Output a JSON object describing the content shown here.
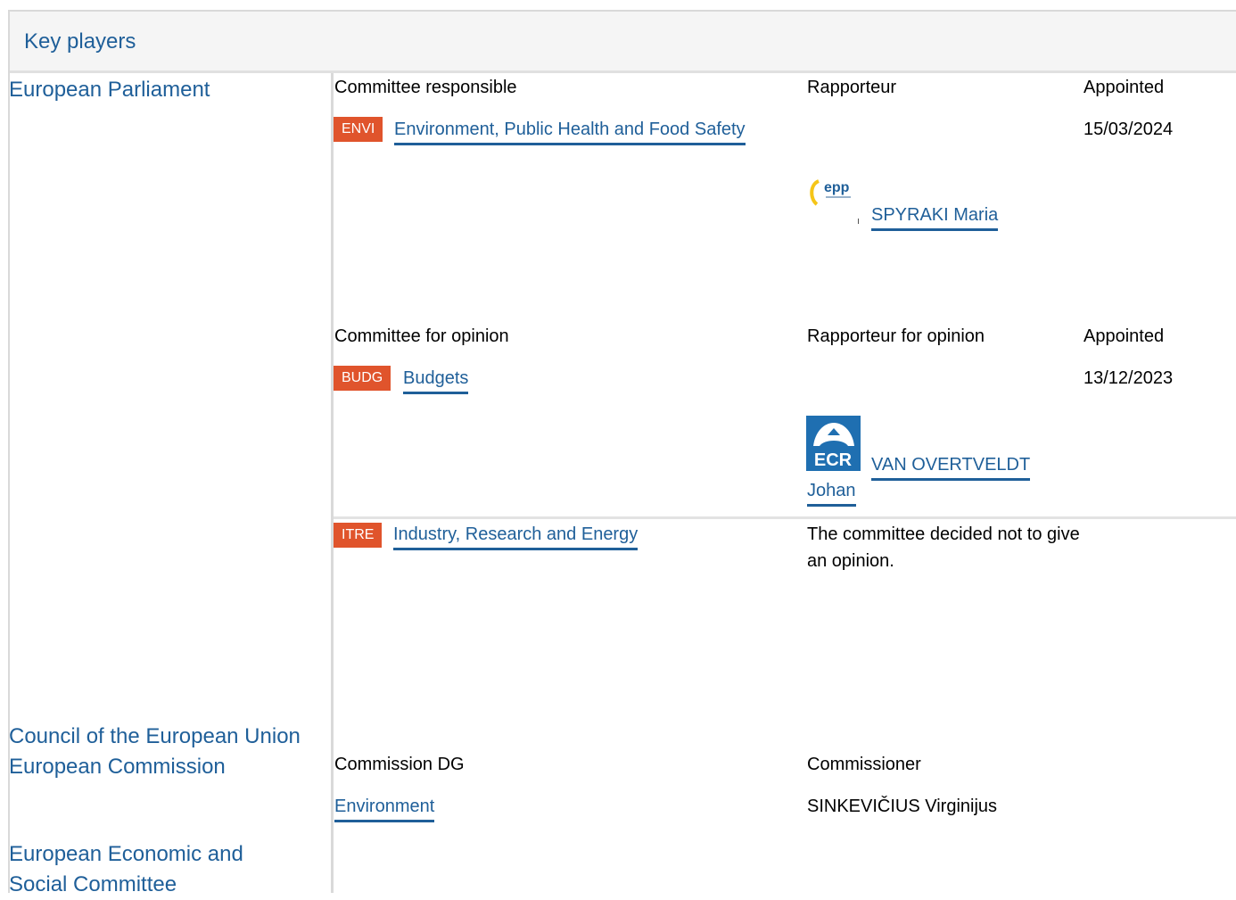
{
  "header": {
    "title": "Key players"
  },
  "institutions": {
    "parliament": "European Parliament",
    "council": "Council of the European Union",
    "commission": "European Commission",
    "eesc": "European Economic and Social Committee"
  },
  "responsible": {
    "col_committee": "Committee responsible",
    "col_rapporteur": "Rapporteur",
    "col_appointed": "Appointed",
    "committee_code": "ENVI",
    "committee_name": "Environment, Public Health and Food Safety",
    "appointed_date": "15/03/2024",
    "rapporteur_name": "SPYRAKI Maria",
    "group_logo": "epp-logo"
  },
  "opinion": {
    "col_committee": "Committee for opinion",
    "col_rapporteur": "Rapporteur for opinion",
    "col_appointed": "Appointed",
    "committee_code": "BUDG",
    "committee_name": "Budgets",
    "appointed_date": "13/12/2023",
    "rapporteur_name_line1": "VAN OVERTVELDT",
    "rapporteur_name_line2": "Johan",
    "group_logo": "ecr-logo",
    "group_logo_text": "ECR"
  },
  "opinion_itre": {
    "committee_code": "ITRE",
    "committee_name": "Industry, Research and Energy",
    "note": "The committee decided not to give an opinion."
  },
  "commission": {
    "col_dg": "Commission DG",
    "col_commissioner": "Commissioner",
    "dg_name": "Environment",
    "commissioner_name": "SINKEVIČIUS Virginijus"
  },
  "colors": {
    "link": "#1f5f99",
    "badge": "#e0542c",
    "divider": "#d9d9d9"
  }
}
